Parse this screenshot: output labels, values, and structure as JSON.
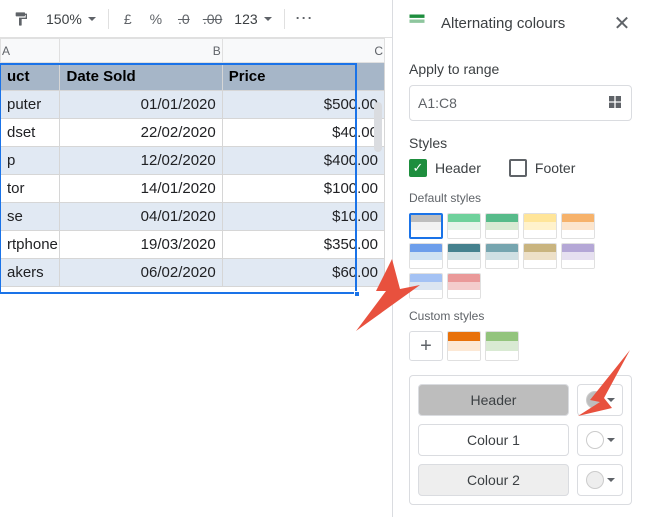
{
  "toolbar": {
    "zoom": "150%",
    "currency": "£",
    "percent": "%",
    "dec_dec": ".0",
    "dec_inc": ".00",
    "num_format": "123",
    "more": "⋯"
  },
  "sheet": {
    "cols": [
      "A",
      "B",
      "C"
    ],
    "header": [
      "uct",
      "Date Sold",
      "Price"
    ],
    "rows": [
      [
        "puter",
        "01/01/2020",
        "$500.00"
      ],
      [
        "dset",
        "22/02/2020",
        "$40.00"
      ],
      [
        "p",
        "12/02/2020",
        "$400.00"
      ],
      [
        "tor",
        "14/01/2020",
        "$100.00"
      ],
      [
        "se",
        "04/01/2020",
        "$10.00"
      ],
      [
        "rtphone",
        "19/03/2020",
        "$350.00"
      ],
      [
        "akers",
        "06/02/2020",
        "$60.00"
      ]
    ]
  },
  "panel": {
    "title": "Alternating colours",
    "apply_label": "Apply to range",
    "range": "A1:C8",
    "styles_label": "Styles",
    "header_chk": "Header",
    "footer_chk": "Footer",
    "default_label": "Default styles",
    "default_styles": [
      {
        "h": "#bdbdbd",
        "a": "#f1f1f1",
        "b": "#ffffff",
        "sel": true
      },
      {
        "h": "#6fd19c",
        "a": "#e6f4ea",
        "b": "#ffffff"
      },
      {
        "h": "#57bb8a",
        "a": "#d9ead3",
        "b": "#ffffff"
      },
      {
        "h": "#ffe599",
        "a": "#fff2cc",
        "b": "#ffffff"
      },
      {
        "h": "#f6b26b",
        "a": "#fce5cd",
        "b": "#ffffff"
      },
      {
        "h": "#6d9eeb",
        "a": "#cfe2f3",
        "b": "#ffffff"
      },
      {
        "h": "#45818e",
        "a": "#d0e0e3",
        "b": "#ffffff"
      },
      {
        "h": "#76a5af",
        "a": "#d0e0e3",
        "b": "#ffffff"
      },
      {
        "h": "#c9b47f",
        "a": "#ede0c8",
        "b": "#ffffff"
      },
      {
        "h": "#b4a7d6",
        "a": "#e6e0f0",
        "b": "#ffffff"
      },
      {
        "h": "#a4c2f4",
        "a": "#dbe5f1",
        "b": "#ffffff"
      },
      {
        "h": "#ea9999",
        "a": "#f4cccc",
        "b": "#ffffff"
      }
    ],
    "custom_label": "Custom styles",
    "custom_styles": [
      {
        "h": "#e8710a",
        "a": "#fce8d5",
        "b": "#ffffff"
      },
      {
        "h": "#93c47d",
        "a": "#d9ead3",
        "b": "#ffffff"
      }
    ],
    "add": "+",
    "header_btn": "Header",
    "colour1_btn": "Colour 1",
    "colour2_btn": "Colour 2",
    "header_color": "#bdbdbd",
    "colour1_color": "#ffffff",
    "colour2_color": "#eeeeee"
  }
}
